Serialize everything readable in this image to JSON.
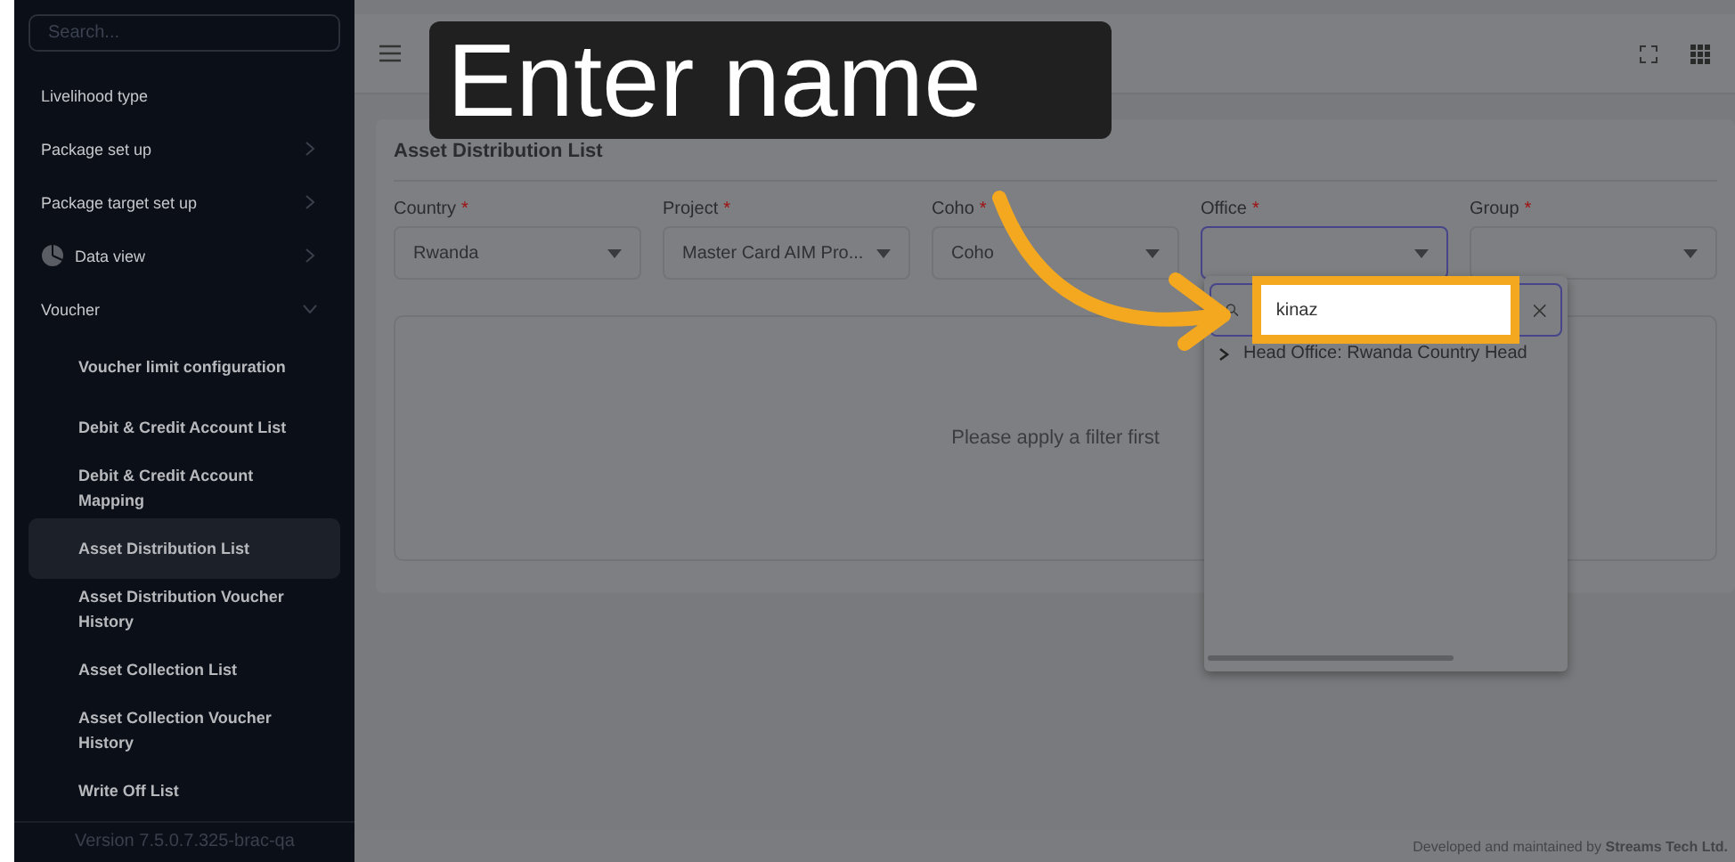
{
  "sidebar": {
    "search": {
      "placeholder": "Search..."
    },
    "items": [
      {
        "label": "Livelihood type",
        "kind": "plain",
        "selected": false
      },
      {
        "label": "Package set up",
        "kind": "collapsed",
        "selected": false
      },
      {
        "label": "Package target set up",
        "kind": "collapsed",
        "selected": false
      },
      {
        "label": "Data view",
        "kind": "collapsed-icon",
        "selected": false
      },
      {
        "label": "Voucher",
        "kind": "expanded",
        "selected": false,
        "children": [
          {
            "label": "Voucher limit configuration",
            "selected": false
          },
          {
            "label": "Debit & Credit Account List",
            "selected": false
          },
          {
            "label": "Debit & Credit Account Mapping",
            "selected": false
          },
          {
            "label": "Asset Distribution List",
            "selected": true
          },
          {
            "label": "Asset Distribution Voucher History",
            "selected": false
          },
          {
            "label": "Asset Collection List",
            "selected": false
          },
          {
            "label": "Asset Collection Voucher History",
            "selected": false
          },
          {
            "label": "Write Off List",
            "selected": false
          }
        ]
      }
    ],
    "version": "Version 7.5.0.7.325-brac-qa"
  },
  "page": {
    "title": "Asset Distribution List",
    "filters": [
      {
        "label": "Country",
        "required_mark": "*",
        "value": "Rwanda",
        "focused": false
      },
      {
        "label": "Project",
        "required_mark": "*",
        "value": "Master Card AIM Pro...",
        "focused": false
      },
      {
        "label": "Coho",
        "required_mark": "*",
        "value": "Coho",
        "focused": false
      },
      {
        "label": "Office",
        "required_mark": "*",
        "focused": true
      },
      {
        "label": "Group",
        "required_mark": "*",
        "focused": false
      }
    ],
    "empty_message": "Please apply a filter first"
  },
  "office_dropdown": {
    "search_value": "kinaz",
    "options": [
      {
        "label": "Head Office: Rwanda Country Head",
        "expanded": false
      }
    ]
  },
  "footer": {
    "text": "Developed and maintained by ",
    "company": "Streams Tech Ltd."
  },
  "callout": {
    "text": "Enter name"
  }
}
